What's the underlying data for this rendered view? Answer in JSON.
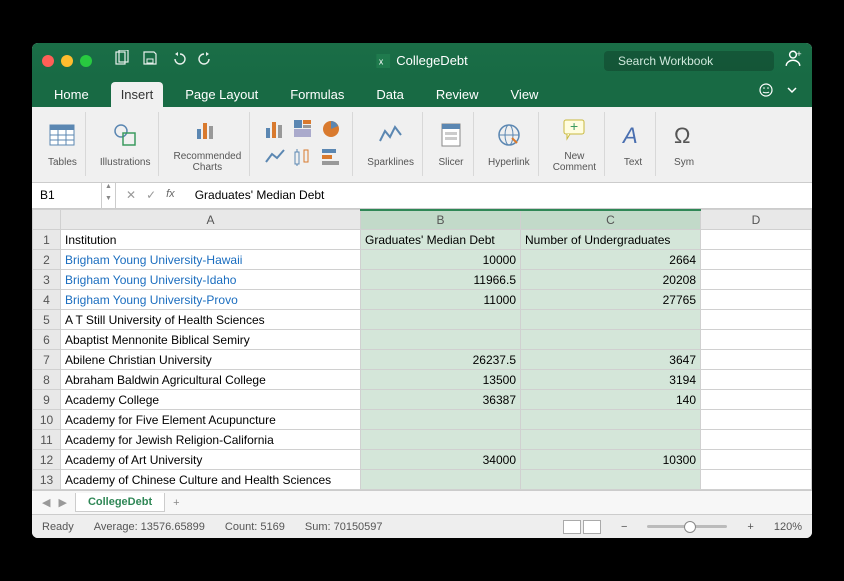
{
  "window": {
    "title": "CollegeDebt",
    "search_placeholder": "Search Workbook"
  },
  "tabs": {
    "items": [
      "Home",
      "Insert",
      "Page Layout",
      "Formulas",
      "Data",
      "Review",
      "View"
    ],
    "active": "Insert"
  },
  "ribbon": {
    "tables": "Tables",
    "illustrations": "Illustrations",
    "recommended": "Recommended\nCharts",
    "sparklines": "Sparklines",
    "slicer": "Slicer",
    "hyperlink": "Hyperlink",
    "newcomment": "New\nComment",
    "text": "Text",
    "symbol": "Sym"
  },
  "formula_bar": {
    "cell_ref": "B1",
    "content": "Graduates' Median Debt"
  },
  "columns": [
    "",
    "A",
    "B",
    "C",
    "D"
  ],
  "rows": [
    {
      "n": "1",
      "a": "Institution",
      "b": "Graduates' Median Debt",
      "c": "Number of Undergraduates",
      "d": "",
      "link": false,
      "balign": "left",
      "calign": "left"
    },
    {
      "n": "2",
      "a": "Brigham Young University-Hawaii",
      "b": "10000",
      "c": "2664",
      "d": "",
      "link": true
    },
    {
      "n": "3",
      "a": "Brigham Young University-Idaho",
      "b": "11966.5",
      "c": "20208",
      "d": "",
      "link": true
    },
    {
      "n": "4",
      "a": "Brigham Young University-Provo",
      "b": "11000",
      "c": "27765",
      "d": "",
      "link": true
    },
    {
      "n": "5",
      "a": "A T Still University of Health Sciences",
      "b": "",
      "c": "",
      "d": "",
      "link": false
    },
    {
      "n": "6",
      "a": "Abaptist Mennonite Biblical Semiry",
      "b": "",
      "c": "",
      "d": "",
      "link": false
    },
    {
      "n": "7",
      "a": "Abilene Christian University",
      "b": "26237.5",
      "c": "3647",
      "d": "",
      "link": false
    },
    {
      "n": "8",
      "a": "Abraham Baldwin Agricultural College",
      "b": "13500",
      "c": "3194",
      "d": "",
      "link": false
    },
    {
      "n": "9",
      "a": "Academy College",
      "b": "36387",
      "c": "140",
      "d": "",
      "link": false
    },
    {
      "n": "10",
      "a": "Academy for Five Element Acupuncture",
      "b": "",
      "c": "",
      "d": "",
      "link": false
    },
    {
      "n": "11",
      "a": "Academy for Jewish Religion-California",
      "b": "",
      "c": "",
      "d": "",
      "link": false
    },
    {
      "n": "12",
      "a": "Academy of Art University",
      "b": "34000",
      "c": "10300",
      "d": "",
      "link": false
    },
    {
      "n": "13",
      "a": "Academy of Chinese Culture and Health Sciences",
      "b": "",
      "c": "",
      "d": "",
      "link": false
    }
  ],
  "sheet_tab": "CollegeDebt",
  "status": {
    "ready": "Ready",
    "avg": "Average: 13576.65899",
    "count": "Count: 5169",
    "sum": "Sum: 70150597",
    "zoom": "120%"
  }
}
